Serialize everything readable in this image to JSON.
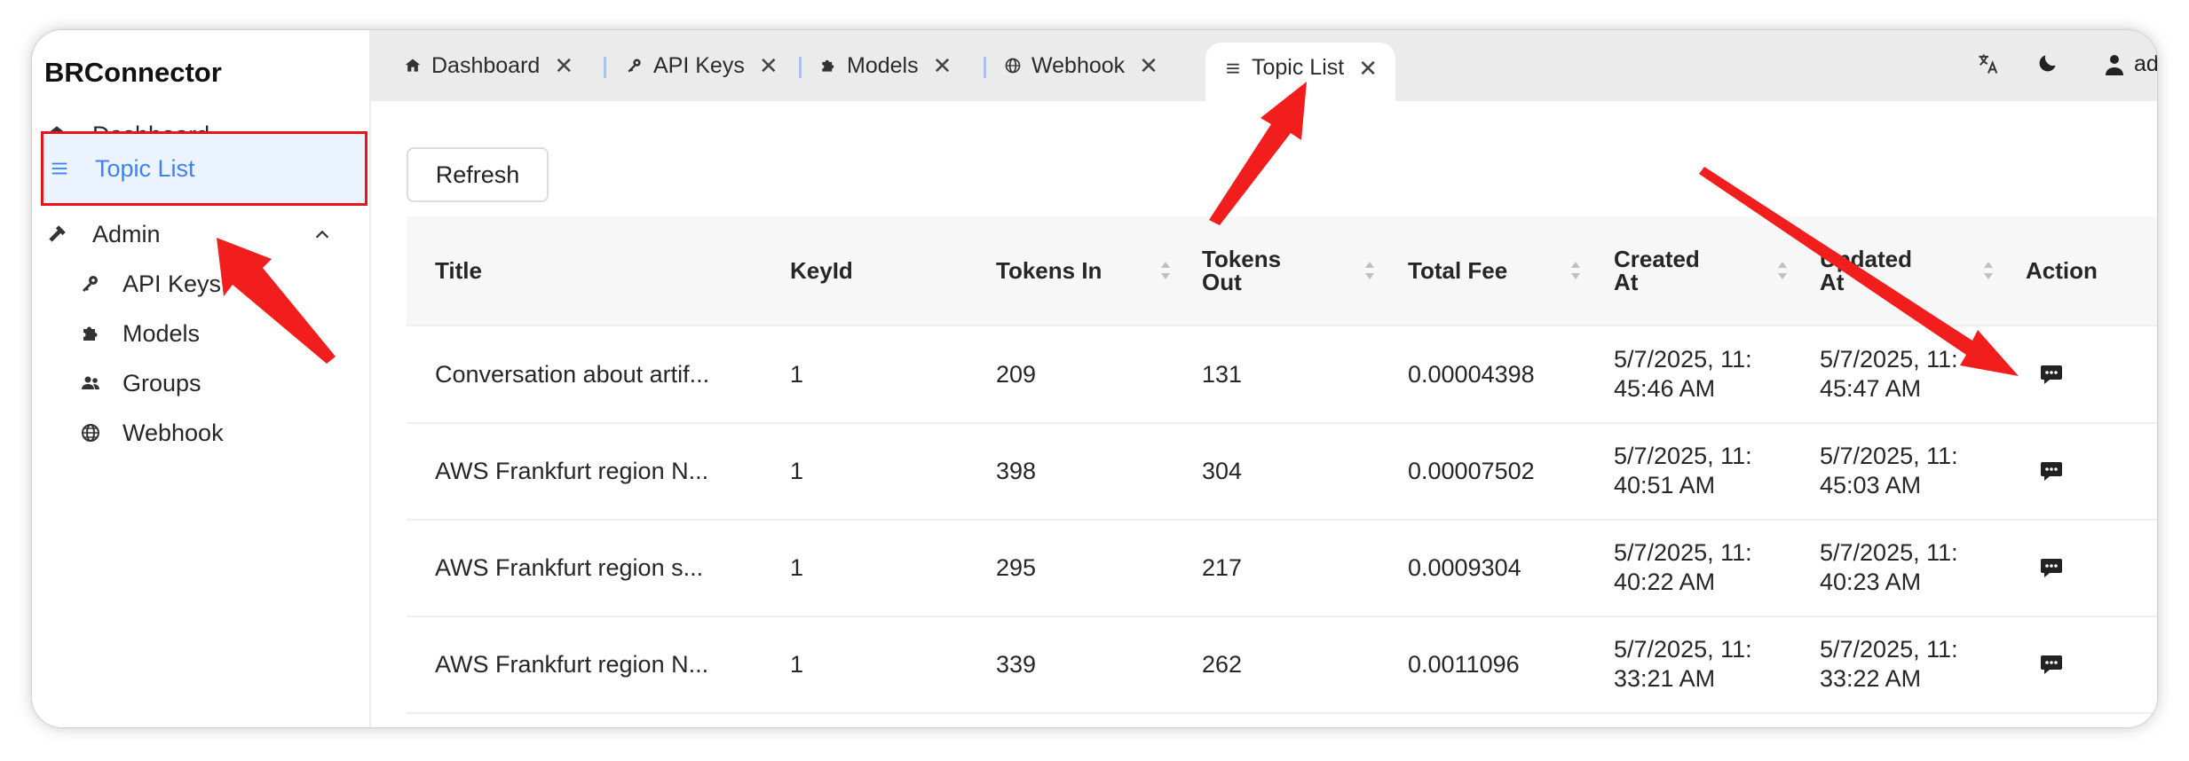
{
  "app": {
    "brand": "BRConnector"
  },
  "sidebar": {
    "items": [
      {
        "label": "Dashboard",
        "icon": "home-icon"
      },
      {
        "label": "Topic List",
        "icon": "list-icon",
        "active": true
      },
      {
        "label": "Admin",
        "icon": "hammer-icon",
        "expanded": true
      },
      {
        "label": "API Keys",
        "icon": "key-icon"
      },
      {
        "label": "Models",
        "icon": "puzzle-icon"
      },
      {
        "label": "Groups",
        "icon": "users-icon"
      },
      {
        "label": "Webhook",
        "icon": "globe-icon"
      }
    ]
  },
  "tabs": [
    {
      "label": "Dashboard",
      "icon": "home-icon"
    },
    {
      "label": "API Keys",
      "icon": "key-icon"
    },
    {
      "label": "Models",
      "icon": "puzzle-icon"
    },
    {
      "label": "Webhook",
      "icon": "globe-icon"
    },
    {
      "label": "Topic List",
      "icon": "list-icon",
      "active": true
    }
  ],
  "topbar": {
    "user": "admin"
  },
  "main": {
    "refresh_label": "Refresh"
  },
  "table": {
    "columns": [
      {
        "label": "Title"
      },
      {
        "label": "KeyId"
      },
      {
        "label": "Tokens In"
      },
      {
        "label": "Tokens Out"
      },
      {
        "label": "Total Fee"
      },
      {
        "label": "Created At"
      },
      {
        "label": "Updated At"
      },
      {
        "label": "Action"
      }
    ],
    "rows": [
      {
        "title": "Conversation about artif...",
        "keyid": "1",
        "tokens_in": "209",
        "tokens_out": "131",
        "total_fee": "0.00004398",
        "created_l1": "5/7/2025, 11:",
        "created_l2": "45:46 AM",
        "updated_l1": "5/7/2025, 11:",
        "updated_l2": "45:47 AM"
      },
      {
        "title": "AWS Frankfurt region N...",
        "keyid": "1",
        "tokens_in": "398",
        "tokens_out": "304",
        "total_fee": "0.00007502",
        "created_l1": "5/7/2025, 11:",
        "created_l2": "40:51 AM",
        "updated_l1": "5/7/2025, 11:",
        "updated_l2": "45:03 AM"
      },
      {
        "title": "AWS Frankfurt region s...",
        "keyid": "1",
        "tokens_in": "295",
        "tokens_out": "217",
        "total_fee": "0.0009304",
        "created_l1": "5/7/2025, 11:",
        "created_l2": "40:22 AM",
        "updated_l1": "5/7/2025, 11:",
        "updated_l2": "40:23 AM"
      },
      {
        "title": "AWS Frankfurt region N...",
        "keyid": "1",
        "tokens_in": "339",
        "tokens_out": "262",
        "total_fee": "0.0011096",
        "created_l1": "5/7/2025, 11:",
        "created_l2": "33:21 AM",
        "updated_l1": "5/7/2025, 11:",
        "updated_l2": "33:22 AM"
      }
    ]
  },
  "colors": {
    "accent": "#3c82f6",
    "annotation": "#e8141a",
    "active_bg": "#ebf3fe"
  }
}
